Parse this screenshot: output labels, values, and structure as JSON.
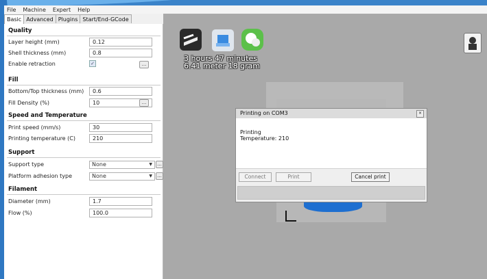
{
  "menu": [
    "File",
    "Machine",
    "Expert",
    "Help"
  ],
  "tabs": [
    "Basic",
    "Advanced",
    "Plugins",
    "Start/End-GCode"
  ],
  "settings": {
    "quality": {
      "title": "Quality",
      "layer_height": {
        "label": "Layer height (mm)",
        "value": "0.12"
      },
      "shell_thickness": {
        "label": "Shell thickness (mm)",
        "value": "0.8"
      },
      "enable_retraction": {
        "label": "Enable retraction",
        "checked": true
      }
    },
    "fill": {
      "title": "Fill",
      "bottom_top": {
        "label": "Bottom/Top thickness (mm)",
        "value": "0.6"
      },
      "density": {
        "label": "Fill Density (%)",
        "value": "10"
      }
    },
    "speed": {
      "title": "Speed and Temperature",
      "print_speed": {
        "label": "Print speed (mm/s)",
        "value": "30"
      },
      "print_temp": {
        "label": "Printing temperature (C)",
        "value": "210"
      }
    },
    "support": {
      "title": "Support",
      "support_type": {
        "label": "Support type",
        "value": "None"
      },
      "adhesion": {
        "label": "Platform adhesion type",
        "value": "None"
      }
    },
    "filament": {
      "title": "Filament",
      "diameter": {
        "label": "Diameter (mm)",
        "value": "1.7"
      },
      "flow": {
        "label": "Flow (%)",
        "value": "100.0"
      }
    },
    "more_button": "..."
  },
  "viewport": {
    "estimate_time": "3 hours 47 minutes",
    "estimate_material": "6.41 meter 18 gram",
    "model_color": "#1e6fd0"
  },
  "dialog": {
    "title": "Printing on COM3",
    "status": "Printing",
    "temperature": "Temperature: 210",
    "connect_label": "Connect",
    "print_label": "Print",
    "cancel_label": "Cancel print"
  }
}
